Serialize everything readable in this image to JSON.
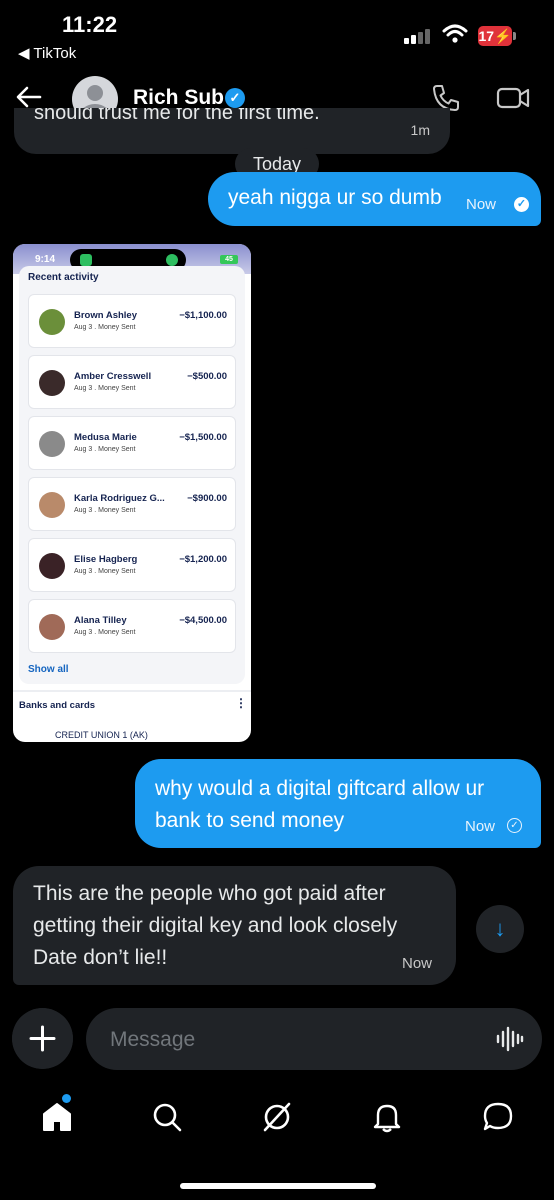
{
  "status_bar": {
    "time": "11:22",
    "back_app": "◀ TikTok",
    "battery": "17"
  },
  "header": {
    "contact_name": "Rich Sub",
    "verified_icon": "verified-badge-icon"
  },
  "messages": {
    "previous_partial": {
      "text": "should trust me for the first time.",
      "time": "1m"
    },
    "date_divider": "Today",
    "sent_1": {
      "text": "yeah nigga ur so dumb",
      "time": "Now"
    },
    "image_screenshot": {
      "status_time": "9:14",
      "battery": "45",
      "section_title": "Recent activity",
      "activity": [
        {
          "name": "Brown Ashley",
          "meta": "Aug 3 . Money Sent",
          "amount": "−$1,100.00",
          "avatar_color": "#6b8f3a"
        },
        {
          "name": "Amber Cresswell",
          "meta": "Aug 3 . Money Sent",
          "amount": "−$500.00",
          "avatar_color": "#3a2a2a"
        },
        {
          "name": "Medusa Marie",
          "meta": "Aug 3 . Money Sent",
          "amount": "−$1,500.00",
          "avatar_color": "#8a8a8a"
        },
        {
          "name": "Karla Rodriguez G...",
          "meta": "Aug 3 . Money Sent",
          "amount": "−$900.00",
          "avatar_color": "#b98a6a"
        },
        {
          "name": "Elise Hagberg",
          "meta": "Aug 3 . Money Sent",
          "amount": "−$1,200.00",
          "avatar_color": "#3a2226"
        },
        {
          "name": "Alana Tilley",
          "meta": "Aug 3 . Money Sent",
          "amount": "−$4,500.00",
          "avatar_color": "#a06a58"
        }
      ],
      "show_all": "Show all",
      "banks_title": "Banks and cards",
      "credit_label": "CREDIT UNION 1 (AK)"
    },
    "sent_2": {
      "text": "why would a digital giftcard allow ur bank to send money",
      "time": "Now"
    },
    "received_1": {
      "text": "This are the people who got paid after getting their digital key and look closely Date don’t lie!!",
      "time": "Now"
    }
  },
  "composer": {
    "placeholder": "Message"
  },
  "colors": {
    "accent": "#1d9bf0",
    "bubble_dark": "#202327",
    "background": "#000000"
  }
}
